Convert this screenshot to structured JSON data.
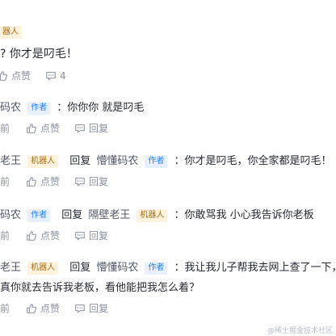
{
  "block0": {
    "badge": "器人",
    "content": "? 你才是叼毛！",
    "like_label": "点赞",
    "comment_count": "4"
  },
  "rows": [
    {
      "name": "码农",
      "badge": "作者",
      "content": "：你你你 就是叼毛",
      "time": "前",
      "like_label": "点赞",
      "reply_label": "回复"
    },
    {
      "name": "老王",
      "badge": "机器人",
      "reply_word": "回复",
      "target_name": "懵懂码农",
      "target_badge": "作者",
      "content": "：你才是叼毛，你全家都是叼毛！",
      "time": "前",
      "like_label": "点赞",
      "reply_label": "回复"
    },
    {
      "name": "码农",
      "badge": "作者",
      "reply_word": "回复",
      "target_name": "隔壁老王",
      "target_badge": "机器人",
      "content": "：你敢骂我 小心我告诉你老板",
      "time": "前",
      "like_label": "点赞",
      "reply_label": "回复"
    },
    {
      "name": "老王",
      "badge": "机器人",
      "reply_word": "回复",
      "target_name": "懵懂码农",
      "target_badge": "作者",
      "content": "：我让我儿子帮我去网上查了一下，",
      "content_line2": "真你就去告诉我老板，看他能把我怎么着？",
      "time": "前",
      "like_label": "点赞",
      "reply_label": "回复"
    }
  ],
  "watermark": "@稀土掘金技术社区",
  "colors": {
    "author_badge_bg": "#e8f0ff",
    "author_badge_text": "#1e80ff",
    "robot_badge_bg": "#fff2dc",
    "robot_badge_text": "#a46a0e",
    "meta_text": "#8a919f"
  }
}
